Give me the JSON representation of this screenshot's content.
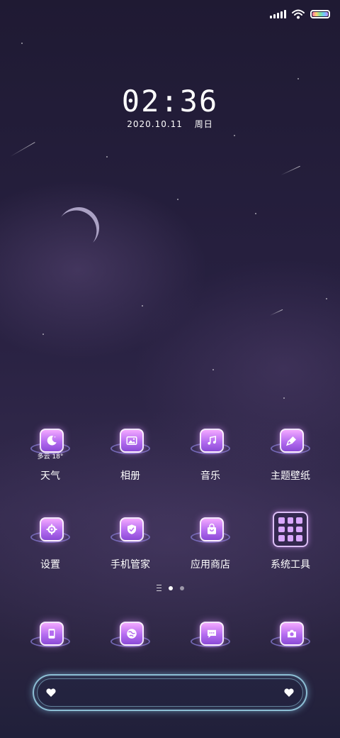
{
  "status_bar": {
    "icons": [
      "signal-icon",
      "wifi-icon",
      "battery-icon"
    ],
    "battery_level": 1.0
  },
  "lock": {
    "time": "02:36",
    "date": "2020.10.11",
    "weekday": "周日"
  },
  "apps": [
    {
      "name": "weather",
      "label": "天气",
      "icon": "moon-icon",
      "sub": "多云 18°"
    },
    {
      "name": "gallery",
      "label": "相册",
      "icon": "image-icon"
    },
    {
      "name": "music",
      "label": "音乐",
      "icon": "music-icon"
    },
    {
      "name": "themes",
      "label": "主题壁纸",
      "icon": "paint-brush-icon"
    },
    {
      "name": "settings",
      "label": "设置",
      "icon": "gear-icon"
    },
    {
      "name": "security",
      "label": "手机管家",
      "icon": "shield-icon"
    },
    {
      "name": "appstore",
      "label": "应用商店",
      "icon": "shopping-bag-icon"
    },
    {
      "name": "tools",
      "label": "系统工具",
      "icon": "folder-icon"
    }
  ],
  "dock_apps": [
    {
      "name": "phone",
      "icon": "phone-icon"
    },
    {
      "name": "browser",
      "icon": "globe-icon"
    },
    {
      "name": "messages",
      "icon": "message-icon"
    },
    {
      "name": "camera",
      "icon": "camera-icon"
    }
  ],
  "pager": {
    "pages": 2,
    "active": 0
  },
  "colors": {
    "accent": "#c87cff",
    "dock_glow": "#a0dcf0"
  }
}
